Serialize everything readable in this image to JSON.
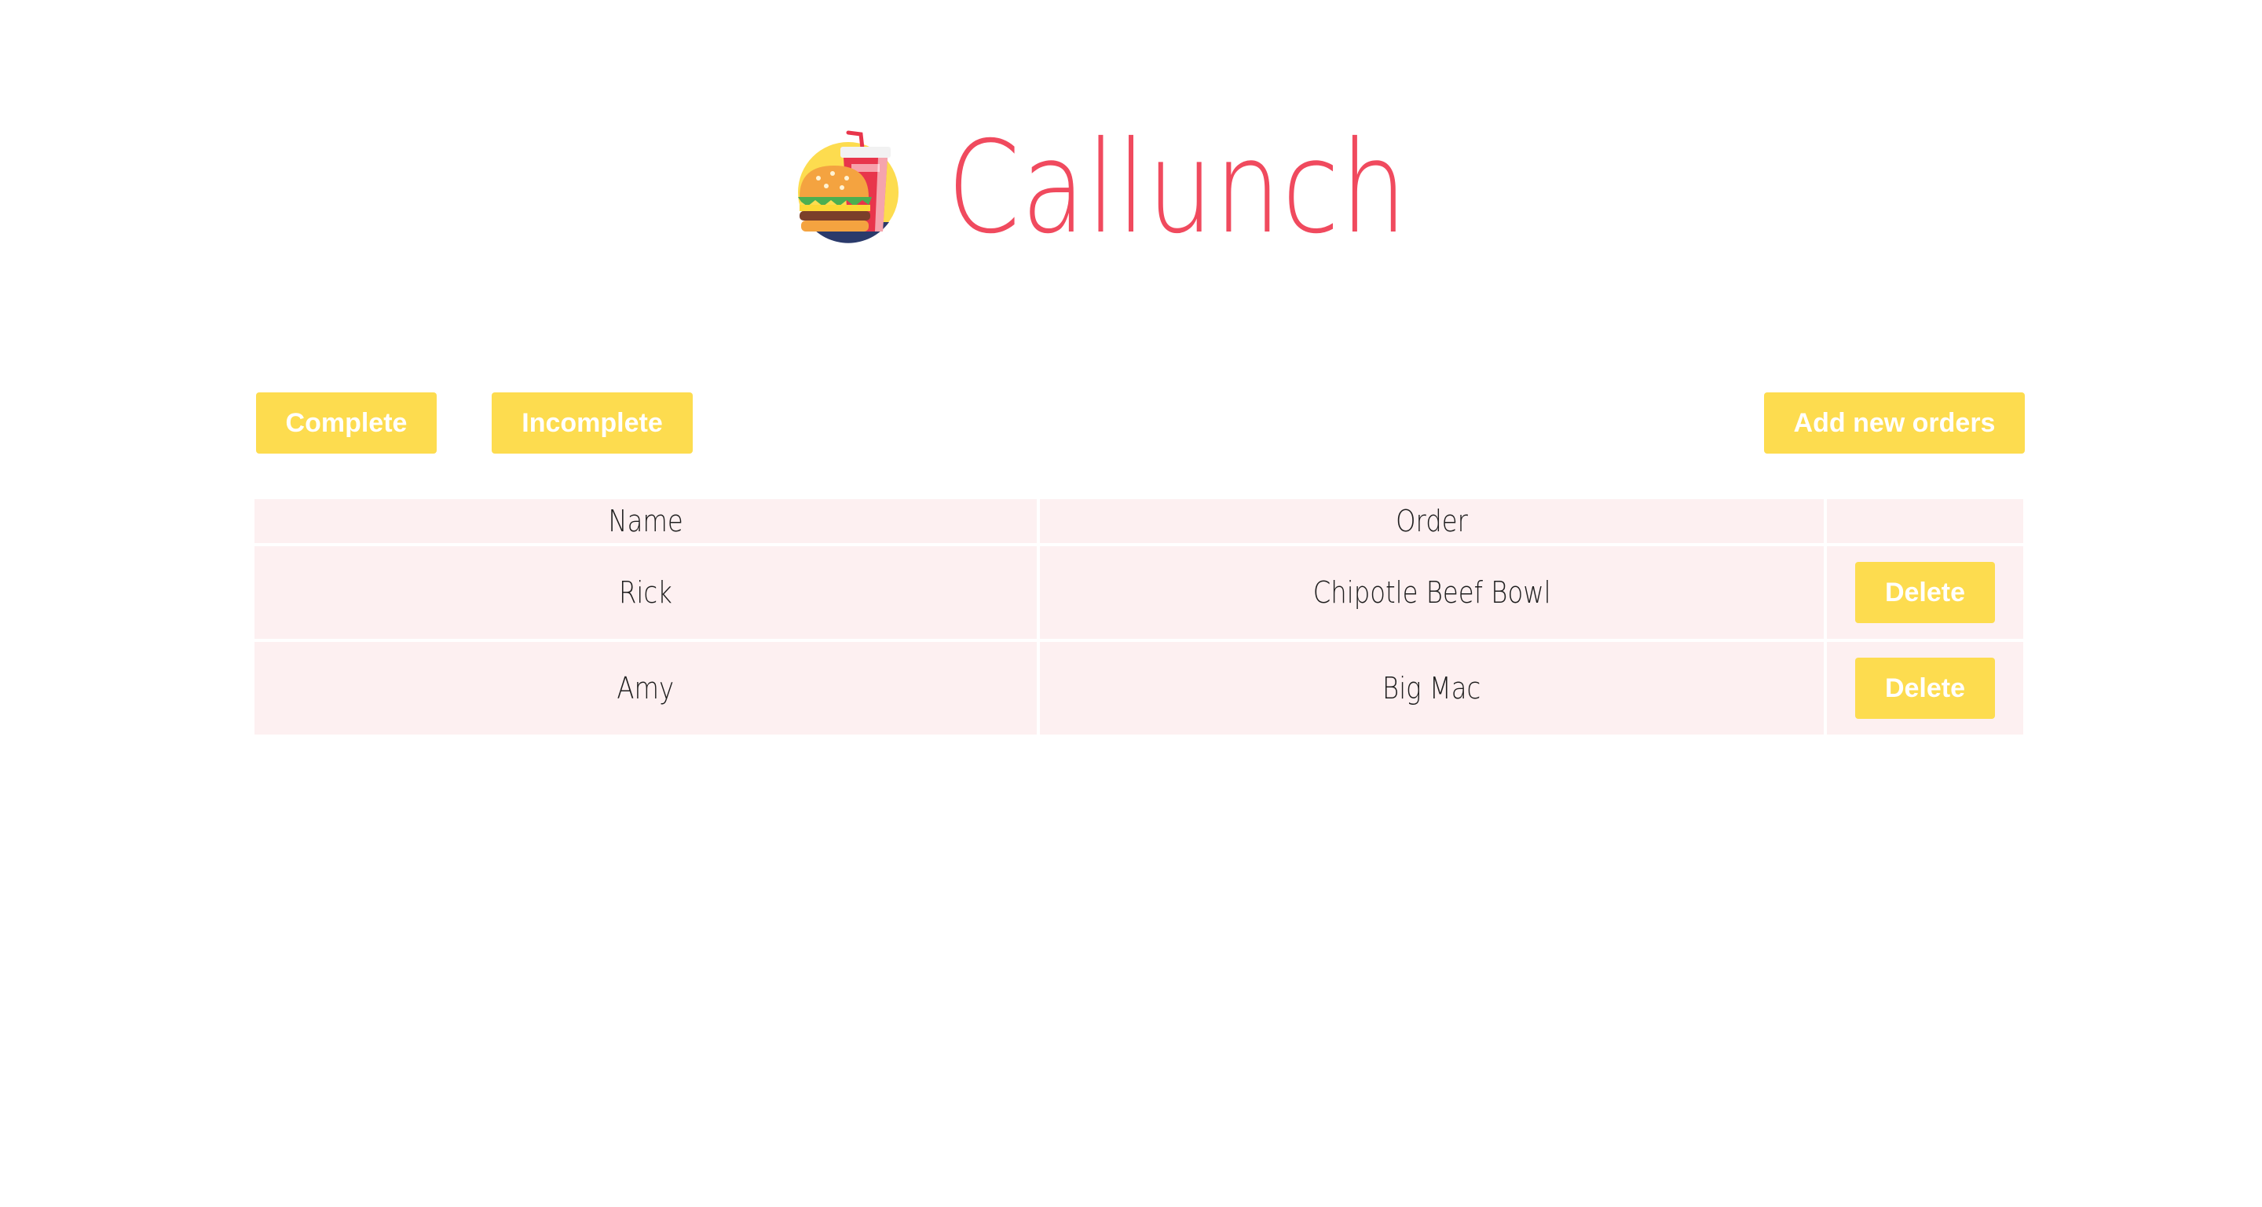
{
  "app": {
    "title": "Callunch",
    "logo_icon": "burger-and-soda-icon"
  },
  "filters": {
    "complete_label": "Complete",
    "incomplete_label": "Incomplete"
  },
  "actions": {
    "add_label": "Add new orders"
  },
  "table": {
    "columns": [
      "Name",
      "Order",
      ""
    ],
    "rows": [
      {
        "name": "Rick",
        "order": "Chipotle Beef Bowl",
        "action": "Delete"
      },
      {
        "name": "Amy",
        "order": "Big Mac",
        "action": "Delete"
      }
    ]
  },
  "colors": {
    "title": "#f04a5e",
    "button": "#fddc4f",
    "button_text": "#ffffff",
    "row_background": "#fdf0f1"
  }
}
